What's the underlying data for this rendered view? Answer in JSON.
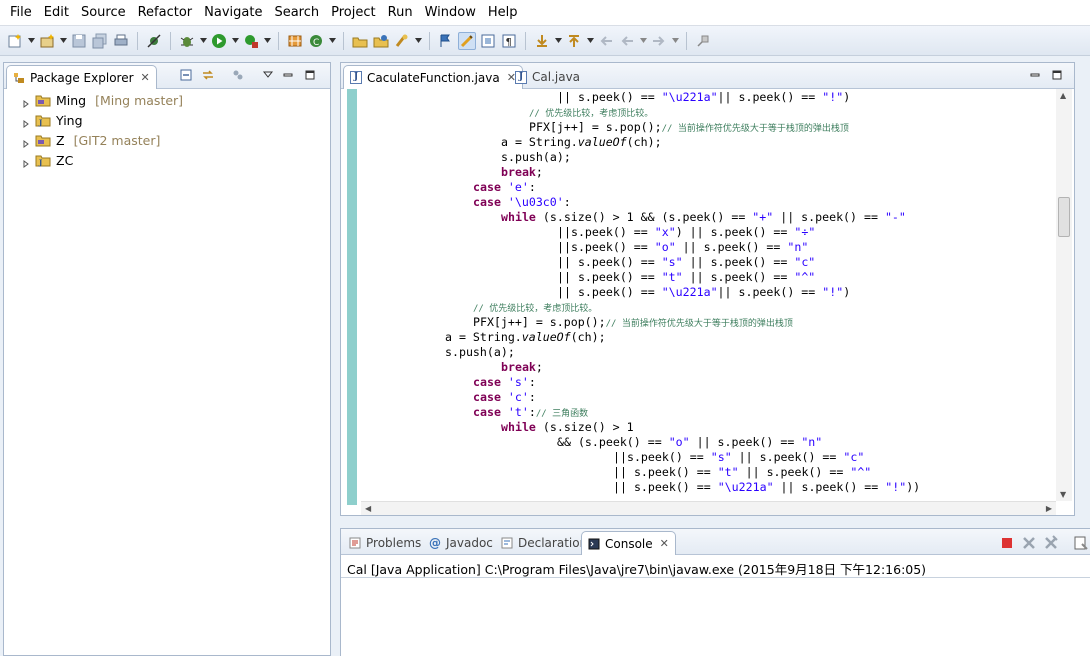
{
  "menu": [
    "File",
    "Edit",
    "Source",
    "Refactor",
    "Navigate",
    "Search",
    "Project",
    "Run",
    "Window",
    "Help"
  ],
  "package_explorer": {
    "tab_label": "Package Explorer",
    "projects": [
      {
        "name": "Ming",
        "decoration": "[Ming master]"
      },
      {
        "name": "Ying",
        "decoration": ""
      },
      {
        "name": "Z",
        "decoration": "[GIT2 master]"
      },
      {
        "name": "ZC",
        "decoration": ""
      }
    ]
  },
  "editor": {
    "tabs": [
      {
        "label": "CaculateFunction.java",
        "active": true
      },
      {
        "label": "Cal.java",
        "active": false
      }
    ],
    "lines": [
      {
        "indent": 24,
        "parts": [
          {
            "t": "|| s.peek() == ",
            "c": ""
          },
          {
            "t": "\"\\u221a\"",
            "c": "str"
          },
          {
            "t": "|| s.peek() == ",
            "c": ""
          },
          {
            "t": "\"!\"",
            "c": "str"
          },
          {
            "t": ")",
            "c": ""
          }
        ]
      },
      {
        "indent": 20,
        "parts": [
          {
            "t": "// 优先级比较，考虑顶比较。",
            "c": "cmt"
          }
        ]
      },
      {
        "indent": 20,
        "parts": [
          {
            "t": "PFX[j++] = s.pop();",
            "c": ""
          },
          {
            "t": "// 当前操作符优先级大于等于栈顶的弹出栈顶",
            "c": "cmt"
          }
        ]
      },
      {
        "indent": 16,
        "parts": [
          {
            "t": "a = String.",
            "c": ""
          },
          {
            "t": "valueOf",
            "c": "it"
          },
          {
            "t": "(ch);",
            "c": ""
          }
        ]
      },
      {
        "indent": 16,
        "parts": [
          {
            "t": "s.push(a);",
            "c": ""
          }
        ]
      },
      {
        "indent": 16,
        "parts": [
          {
            "t": "break",
            "c": "kw"
          },
          {
            "t": ";",
            "c": ""
          }
        ]
      },
      {
        "indent": 12,
        "parts": [
          {
            "t": "case",
            "c": "kw"
          },
          {
            "t": " ",
            "c": ""
          },
          {
            "t": "'e'",
            "c": "str"
          },
          {
            "t": ":",
            "c": ""
          }
        ]
      },
      {
        "indent": 12,
        "parts": [
          {
            "t": "case",
            "c": "kw"
          },
          {
            "t": " ",
            "c": ""
          },
          {
            "t": "'\\u03c0'",
            "c": "str"
          },
          {
            "t": ":",
            "c": ""
          }
        ]
      },
      {
        "indent": 16,
        "parts": [
          {
            "t": "while",
            "c": "kw"
          },
          {
            "t": " (s.size() > 1 && (s.peek() == ",
            "c": ""
          },
          {
            "t": "\"+\"",
            "c": "str"
          },
          {
            "t": " || s.peek() == ",
            "c": ""
          },
          {
            "t": "\"-\"",
            "c": "str"
          }
        ]
      },
      {
        "indent": 24,
        "parts": [
          {
            "t": "||s.peek() == ",
            "c": ""
          },
          {
            "t": "\"x\"",
            "c": "str"
          },
          {
            "t": ") || s.peek() == ",
            "c": ""
          },
          {
            "t": "\"÷\"",
            "c": "str"
          }
        ]
      },
      {
        "indent": 24,
        "parts": [
          {
            "t": "||s.peek() == ",
            "c": ""
          },
          {
            "t": "\"o\"",
            "c": "str"
          },
          {
            "t": " || s.peek() == ",
            "c": ""
          },
          {
            "t": "\"n\"",
            "c": "str"
          }
        ]
      },
      {
        "indent": 24,
        "parts": [
          {
            "t": "|| s.peek() == ",
            "c": ""
          },
          {
            "t": "\"s\"",
            "c": "str"
          },
          {
            "t": " || s.peek() == ",
            "c": ""
          },
          {
            "t": "\"c\"",
            "c": "str"
          }
        ]
      },
      {
        "indent": 24,
        "parts": [
          {
            "t": "|| s.peek() == ",
            "c": ""
          },
          {
            "t": "\"t\"",
            "c": "str"
          },
          {
            "t": " || s.peek() == ",
            "c": ""
          },
          {
            "t": "\"^\"",
            "c": "str"
          }
        ]
      },
      {
        "indent": 24,
        "parts": [
          {
            "t": "|| s.peek() == ",
            "c": ""
          },
          {
            "t": "\"\\u221a\"",
            "c": "str"
          },
          {
            "t": "|| s.peek() == ",
            "c": ""
          },
          {
            "t": "\"!\"",
            "c": "str"
          },
          {
            "t": ")",
            "c": ""
          }
        ]
      },
      {
        "indent": 12,
        "parts": [
          {
            "t": "// 优先级比较，考虑顶比较。",
            "c": "cmt"
          }
        ]
      },
      {
        "indent": 12,
        "parts": [
          {
            "t": "PFX[j++] = s.pop();",
            "c": ""
          },
          {
            "t": "// 当前操作符优先级大于等于栈顶的弹出栈顶",
            "c": "cmt"
          }
        ]
      },
      {
        "indent": 8,
        "parts": [
          {
            "t": "a = String.",
            "c": ""
          },
          {
            "t": "valueOf",
            "c": "it"
          },
          {
            "t": "(ch);",
            "c": ""
          }
        ]
      },
      {
        "indent": 8,
        "parts": [
          {
            "t": "s.push(a);",
            "c": ""
          }
        ]
      },
      {
        "indent": 16,
        "parts": [
          {
            "t": "break",
            "c": "kw"
          },
          {
            "t": ";",
            "c": ""
          }
        ]
      },
      {
        "indent": 12,
        "parts": [
          {
            "t": "case",
            "c": "kw"
          },
          {
            "t": " ",
            "c": ""
          },
          {
            "t": "'s'",
            "c": "str"
          },
          {
            "t": ":",
            "c": ""
          }
        ]
      },
      {
        "indent": 12,
        "parts": [
          {
            "t": "case",
            "c": "kw"
          },
          {
            "t": " ",
            "c": ""
          },
          {
            "t": "'c'",
            "c": "str"
          },
          {
            "t": ":",
            "c": ""
          }
        ]
      },
      {
        "indent": 12,
        "parts": [
          {
            "t": "case",
            "c": "kw"
          },
          {
            "t": " ",
            "c": ""
          },
          {
            "t": "'t'",
            "c": "str"
          },
          {
            "t": ":",
            "c": ""
          },
          {
            "t": "// 三角函数",
            "c": "cmt"
          }
        ]
      },
      {
        "indent": 16,
        "parts": [
          {
            "t": "while",
            "c": "kw"
          },
          {
            "t": " (s.size() > 1",
            "c": ""
          }
        ]
      },
      {
        "indent": 24,
        "parts": [
          {
            "t": "&& (s.peek() == ",
            "c": ""
          },
          {
            "t": "\"o\"",
            "c": "str"
          },
          {
            "t": " || s.peek() == ",
            "c": ""
          },
          {
            "t": "\"n\"",
            "c": "str"
          }
        ]
      },
      {
        "indent": 32,
        "parts": [
          {
            "t": "||s.peek() == ",
            "c": ""
          },
          {
            "t": "\"s\"",
            "c": "str"
          },
          {
            "t": " || s.peek() == ",
            "c": ""
          },
          {
            "t": "\"c\"",
            "c": "str"
          }
        ]
      },
      {
        "indent": 32,
        "parts": [
          {
            "t": "|| s.peek() == ",
            "c": ""
          },
          {
            "t": "\"t\"",
            "c": "str"
          },
          {
            "t": " || s.peek() == ",
            "c": ""
          },
          {
            "t": "\"^\"",
            "c": "str"
          }
        ]
      },
      {
        "indent": 32,
        "parts": [
          {
            "t": "|| s.peek() == ",
            "c": ""
          },
          {
            "t": "\"\\u221a\"",
            "c": "str"
          },
          {
            "t": " || s.peek() == ",
            "c": ""
          },
          {
            "t": "\"!\"",
            "c": "str"
          },
          {
            "t": "))",
            "c": ""
          }
        ]
      }
    ]
  },
  "bottom_panel": {
    "tabs": [
      {
        "label": "Problems",
        "icon": "problems-icon",
        "active": false
      },
      {
        "label": "Javadoc",
        "icon": "javadoc-icon",
        "active": false
      },
      {
        "label": "Declaration",
        "icon": "declaration-icon",
        "active": false
      },
      {
        "label": "Console",
        "icon": "console-icon",
        "active": true
      }
    ],
    "console_title": "Cal [Java Application] C:\\Program Files\\Java\\jre7\\bin\\javaw.exe (2015年9月18日 下午12:16:05)"
  },
  "colors": {
    "keyword": "#7f0055",
    "string": "#2a00ff",
    "comment": "#3f7f5f",
    "ruler": "#8ecfcc",
    "git_decoration": "#95825a"
  }
}
